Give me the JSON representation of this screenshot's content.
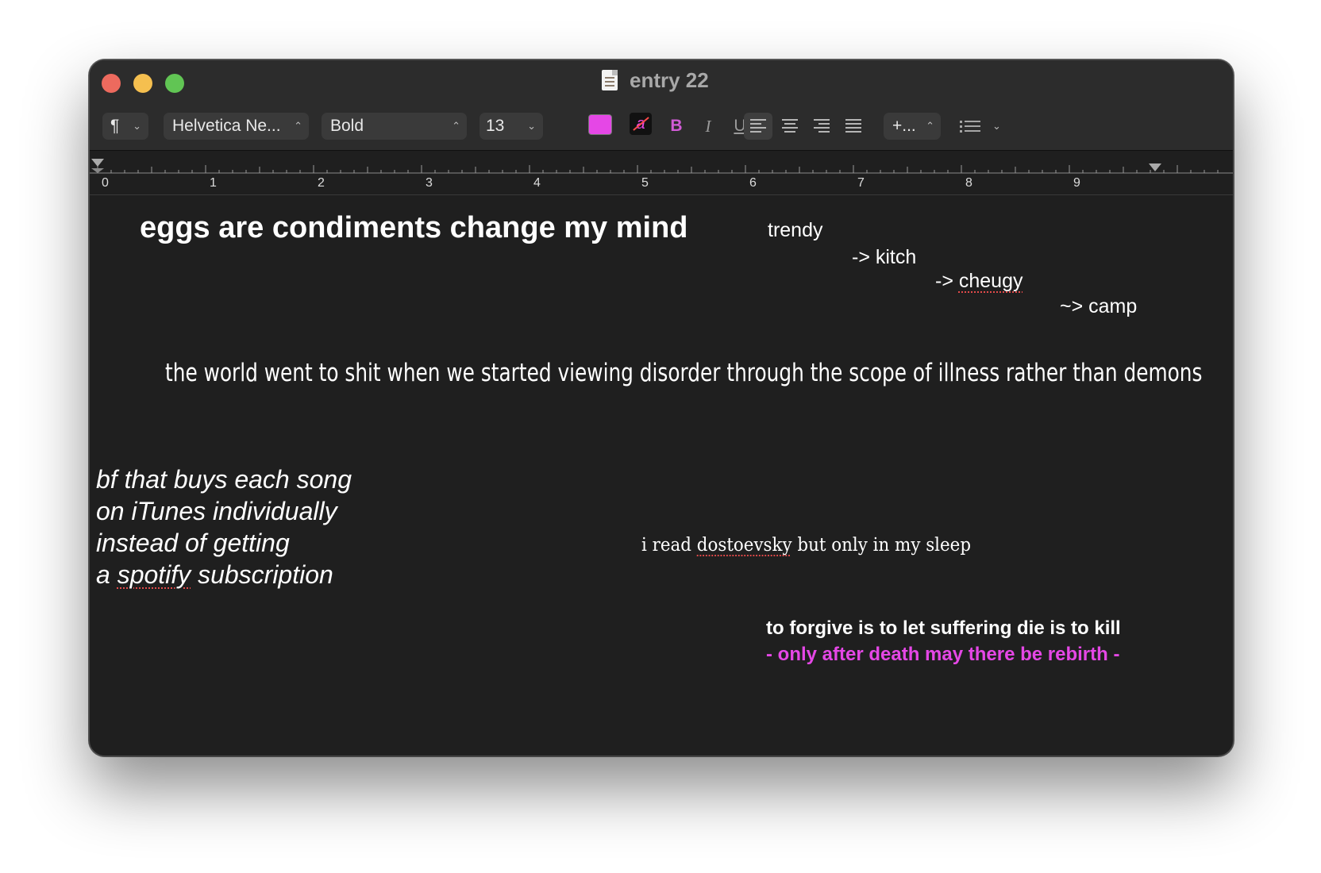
{
  "window": {
    "title": "entry 22"
  },
  "toolbar": {
    "paragraph_icon": "¶",
    "font_family": "Helvetica Ne...",
    "font_style": "Bold",
    "font_size": "13",
    "text_color": "#e547e6",
    "bold_label": "B",
    "italic_label": "I",
    "underline_label": "U",
    "spacing_label": "+...",
    "list_icon": "list-bullet-icon"
  },
  "ruler": {
    "labels": [
      "0",
      "1",
      "2",
      "3",
      "4",
      "5",
      "6",
      "7",
      "8",
      "9"
    ]
  },
  "document": {
    "heading": "eggs are condiments change my mind",
    "trend_1": "trendy",
    "trend_2": "-> kitch",
    "trend_3_prefix": "-> ",
    "trend_3_word": "cheugy",
    "trend_4": "~> camp",
    "world_line": "the world went to shit when we started viewing disorder through the scope of illness rather than demons",
    "poem": {
      "line_1": "bf that buys each song",
      "line_2": "on iTunes individually",
      "line_3": "instead of getting",
      "line_4_prefix": "a ",
      "line_4_word": "spotify",
      "line_4_suffix": " subscription"
    },
    "dostoevsky": {
      "prefix": "i read ",
      "word": "dostoevsky",
      "suffix": " but only in my sleep"
    },
    "forgive_line": "to forgive is to let suffering die is to kill",
    "rebirth_line": "- only after death may there be rebirth -"
  }
}
